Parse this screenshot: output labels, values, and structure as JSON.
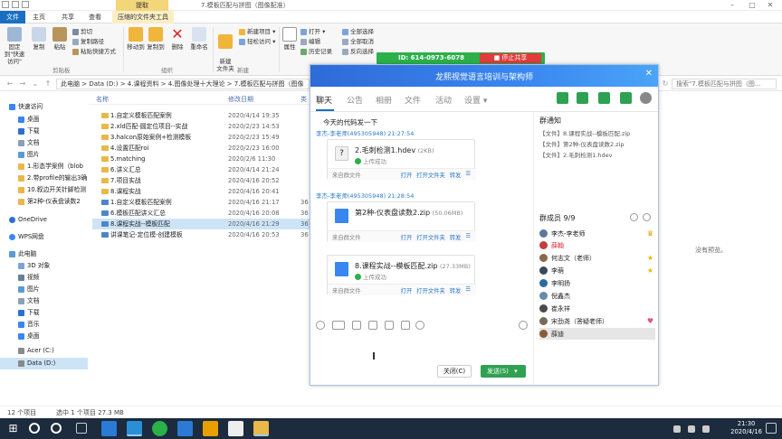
{
  "window": {
    "title": "7.模板匹配与拼图（图像配准）",
    "extract_tab": "提取",
    "ribbon_tabs": [
      "文件",
      "主页",
      "共享",
      "查看",
      "压缩的文件夹工具"
    ]
  },
  "ribbon": {
    "pin_label": "固定到\"快速访问\"",
    "copy_label": "复制",
    "paste_label": "粘贴",
    "cut_label": "剪切",
    "copy_path_label": "复制路径",
    "paste_shortcut_label": "粘贴快捷方式",
    "clipboard_group": "剪贴板",
    "move_to_label": "移动到",
    "copy_to_label": "复制到",
    "delete_label": "删除",
    "rename_label": "重命名",
    "organize_group": "组织",
    "new_folder_label": "新建\n文件夹",
    "new_item_label": "新建项目 ▾",
    "easy_access_label": "轻松访问 ▾",
    "new_group": "新建",
    "properties_label": "属性",
    "open_label": "打开 ▾",
    "edit_label": "编辑",
    "history_label": "历史记录",
    "select_all_label": "全部选择",
    "select_none_label": "全部取消",
    "invert_label": "反向选择"
  },
  "remote": {
    "id_text": "ID: 614-0973-6078",
    "stop_label": "■ 停止共享"
  },
  "address": {
    "path": "此电脑  >  Data (D:)  >  4.课程资料  >  4.图像处理十大理论  >  7.模板匹配与拼图（图像",
    "search_placeholder": "搜索\"7.模板匹配与拼图（图..."
  },
  "nav": {
    "items": [
      "快速访问",
      "桌面",
      "下载",
      "文档",
      "图片",
      "1.形态学案例（blob",
      "2.带profile的输出3确",
      "10.叙边开关针脚检测",
      "第2种-仪表盘读数2",
      "OneDrive",
      "WPS网盘",
      "此电脑",
      "3D 对象",
      "视频",
      "图片",
      "文档",
      "下载",
      "音乐",
      "桌面",
      "Acer (C:)",
      "Data (D:)"
    ]
  },
  "filelist": {
    "columns": {
      "name": "名称",
      "date": "修改日期",
      "type": "类"
    },
    "rows": [
      {
        "name": "1.自定义模板匹配案例",
        "date": "2020/4/14 19:35",
        "size": ""
      },
      {
        "name": "2.xld匹配-圆定位项目--实战",
        "date": "2020/2/23 14:53",
        "size": ""
      },
      {
        "name": "3.halcon原始案例+检测模板",
        "date": "2020/2/23 15:49",
        "size": ""
      },
      {
        "name": "4.设置匹配roi",
        "date": "2020/2/23 16:00",
        "size": ""
      },
      {
        "name": "5.matching",
        "date": "2020/2/6 11:30",
        "size": ""
      },
      {
        "name": "6.讲义汇总",
        "date": "2020/4/14 21:24",
        "size": ""
      },
      {
        "name": "7.项目实战",
        "date": "2020/4/16 20:52",
        "size": ""
      },
      {
        "name": "8.课程实战",
        "date": "2020/4/16 20:41",
        "size": ""
      },
      {
        "name": "1.自定义模板匹配案例",
        "date": "2020/4/16 21:17",
        "size": "36"
      },
      {
        "name": "6.模板匹配讲义汇总",
        "date": "2020/4/16 20:08",
        "size": "36"
      },
      {
        "name": "8.课程实战--模板匹配",
        "date": "2020/4/16 21:29",
        "size": "36"
      },
      {
        "name": "讲课笔记-定位模-创建模板",
        "date": "2020/4/16 20:53",
        "size": "36"
      }
    ],
    "no_preview": "没有预览。"
  },
  "status": {
    "count": "12 个项目",
    "selected": "选中 1 个项目  27.3 MB"
  },
  "taskbar": {
    "time": "21:30",
    "date": "2020/4/16"
  },
  "qq": {
    "group_name": "龙熙视觉语言培训与架构师",
    "tabs": [
      "聊天",
      "公告",
      "相册",
      "文件",
      "活动",
      "设置 ▾"
    ],
    "messages": {
      "top_text": "今天的代码发一下",
      "sender1": "李杰-李老师(495305948)  21:27:54",
      "file1_name": "2.毛刺检测1.hdev",
      "file1_size": "(2KB)",
      "sender2": "李杰-李老师(495305948)  21:28:54",
      "file2_name": "第2种-仪表盘读数2.zip",
      "file2_size": "(50.06MB)",
      "file3_name": "8.课程实战--模板匹配.zip",
      "file3_size": "(27.33MB)",
      "uploaded": "上传成功",
      "source": "来自群文件",
      "act_open": "打开",
      "act_folder": "打开文件夹",
      "act_forward": "转发"
    },
    "close_label": "关闭(C)",
    "send_label": "发送(S)",
    "send_arrow": "▾",
    "sidebar": {
      "notice_title": "群通知",
      "notices": [
        "【文件】8.课程实战--模板匹配.zip",
        "【文件】第2种-仪表盘读数2.zip",
        "【文件】2.毛刺检测1.hdev"
      ],
      "members_title": "群成员 9/9",
      "members": [
        "李杰-李老师",
        "薛翰",
        "何志文（老师）",
        "李萌",
        "李明扬",
        "倪鑫杰",
        "崔永祥",
        "宋劲尧（答疑老师）",
        "薛迪"
      ]
    }
  }
}
